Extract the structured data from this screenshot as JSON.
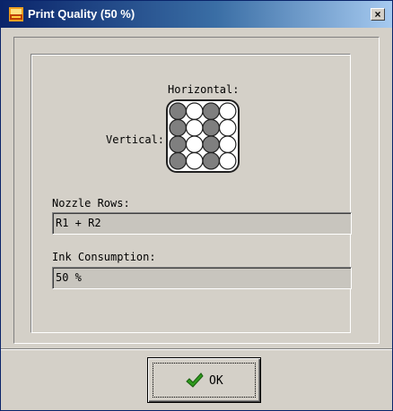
{
  "window": {
    "title": "Print Quality (50 %)",
    "close_glyph": "×",
    "app_icon": "printer-app-icon"
  },
  "nozzle_pattern": {
    "horizontal_label": "Horizontal:",
    "vertical_label": "Vertical:",
    "grid": [
      [
        "filled",
        "empty",
        "filled",
        "empty"
      ],
      [
        "filled",
        "empty",
        "filled",
        "empty"
      ],
      [
        "filled",
        "empty",
        "filled",
        "empty"
      ],
      [
        "filled",
        "empty",
        "filled",
        "empty"
      ]
    ],
    "colors": {
      "filled": "#7f7f7f",
      "empty": "#ffffff",
      "outline": "#202020"
    }
  },
  "nozzle_rows": {
    "label": "Nozzle Rows:",
    "value": "R1 + R2"
  },
  "ink_consumption": {
    "label": "Ink Consumption:",
    "value": "50 %"
  },
  "ok_button": {
    "label": "OK",
    "icon": "checkmark-icon",
    "icon_color": "#2e9a1c"
  }
}
